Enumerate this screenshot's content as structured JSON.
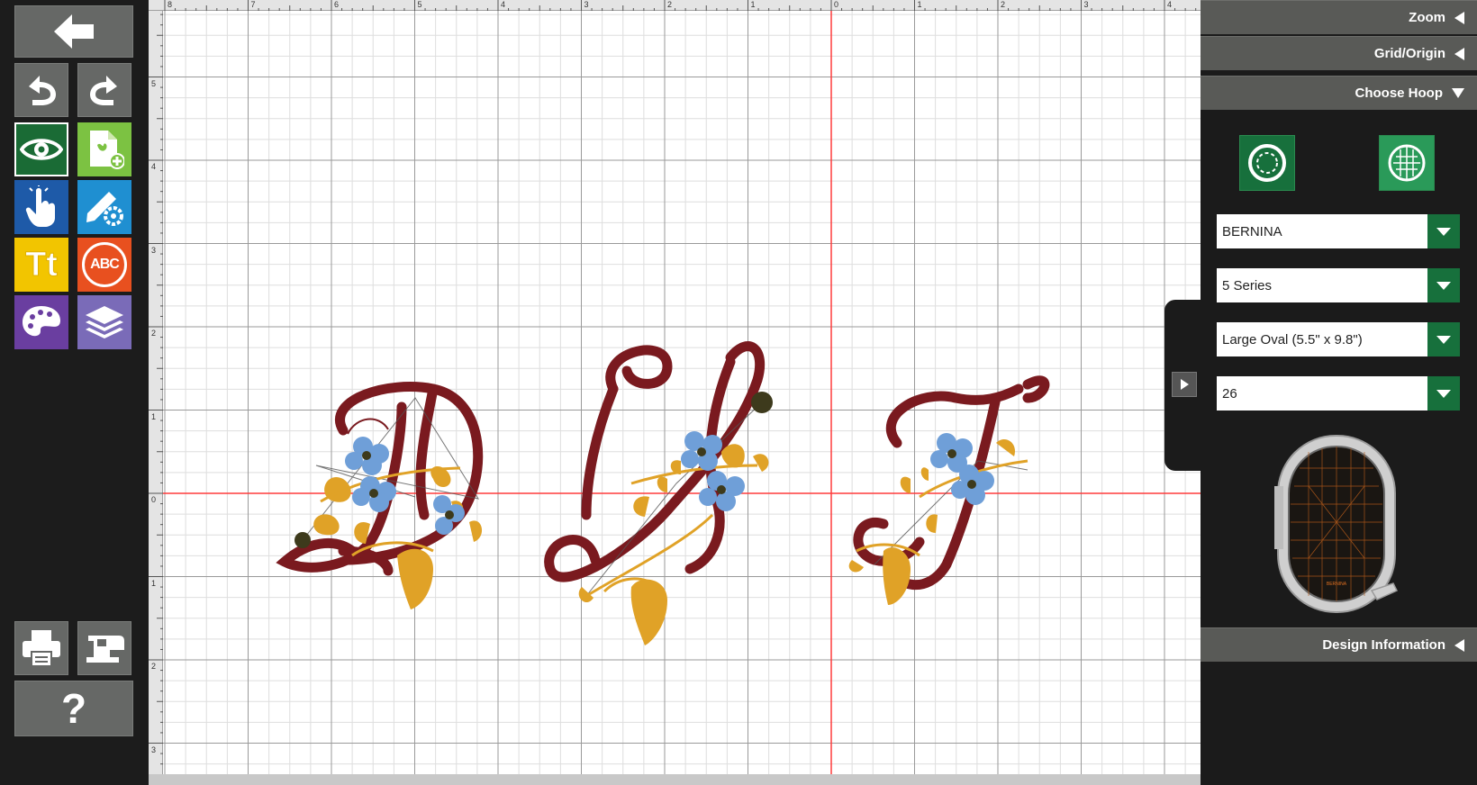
{
  "toolbar": {
    "buttons": [
      {
        "name": "back",
        "icon": "arrow-left-icon"
      },
      {
        "name": "undo",
        "icon": "undo-icon"
      },
      {
        "name": "redo",
        "icon": "redo-icon"
      },
      {
        "name": "view",
        "icon": "eye-icon",
        "color": "#1a6b35"
      },
      {
        "name": "add-design",
        "icon": "file-add-icon",
        "color": "#7cc242"
      },
      {
        "name": "select",
        "icon": "hand-pointer-icon",
        "color": "#1e5aa8"
      },
      {
        "name": "edit",
        "icon": "pencil-gear-icon",
        "color": "#1f8fd1"
      },
      {
        "name": "text",
        "icon": "text-tt-icon",
        "color": "#f2c500",
        "label": "Tt"
      },
      {
        "name": "monogram",
        "icon": "monogram-abc-icon",
        "color": "#e8501f",
        "label": "ABC"
      },
      {
        "name": "color",
        "icon": "palette-icon",
        "color": "#6a3ea0"
      },
      {
        "name": "layers",
        "icon": "layers-icon",
        "color": "#7a6bb8"
      },
      {
        "name": "print",
        "icon": "printer-icon"
      },
      {
        "name": "send-to-machine",
        "icon": "sewing-machine-icon"
      },
      {
        "name": "help",
        "icon": "question-icon",
        "label": "?"
      }
    ]
  },
  "rulers": {
    "top": [
      "8",
      "7",
      "6",
      "5",
      "4",
      "3",
      "2",
      "1",
      "0",
      "1",
      "2",
      "3",
      "4"
    ],
    "left": [
      "5",
      "4",
      "3",
      "2",
      "1",
      "0",
      "1",
      "2",
      "3"
    ]
  },
  "canvas": {
    "monogram_letters": [
      "D",
      "S",
      "J"
    ],
    "colors": {
      "thread_main": "#7a1a1f",
      "thread_leaf": "#e0a227",
      "thread_flower": "#6f9fd8",
      "flower_center": "#3d3a1c",
      "axis": "#ff3b3b",
      "grid_major": "#9a9a9a",
      "grid_minor": "#dedede"
    }
  },
  "panel": {
    "zoom": "Zoom",
    "grid_origin": "Grid/Origin",
    "choose_hoop": "Choose Hoop",
    "design_information": "Design Information",
    "hoop_buttons": [
      {
        "icon": "hoop-circle-icon"
      },
      {
        "icon": "hoop-grid-icon"
      }
    ],
    "brand": "BERNINA",
    "series": "5 Series",
    "hoop": "Large Oval (5.5\" x 9.8\")",
    "hoop_number": "26",
    "hoop_preview_label": "BERNINA",
    "accent": "#17703c"
  }
}
